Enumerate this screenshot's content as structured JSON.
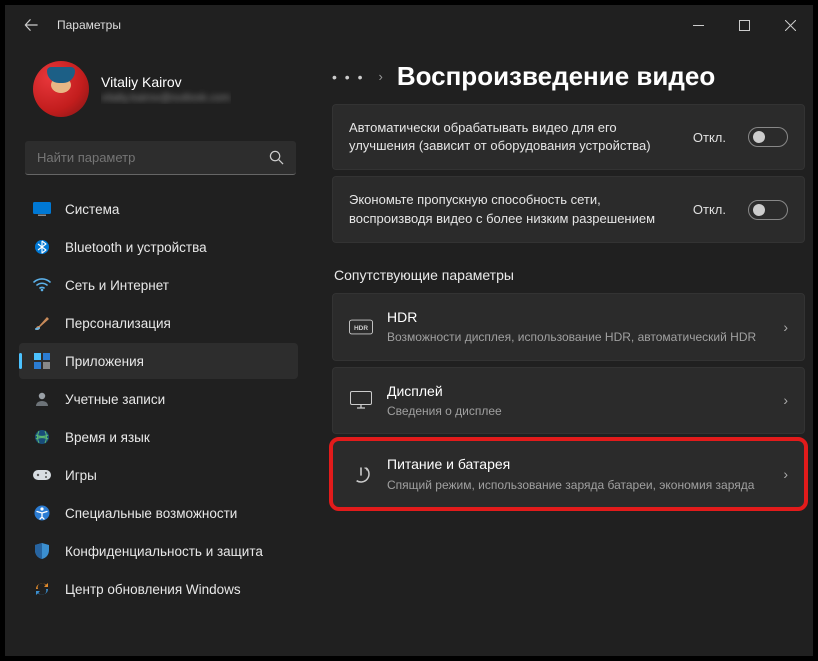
{
  "window": {
    "title": "Параметры"
  },
  "user": {
    "name": "Vitaliy Kairov",
    "email": "vitaliy.kairov@outlook.com"
  },
  "search": {
    "placeholder": "Найти параметр"
  },
  "sidebar": {
    "items": [
      {
        "label": "Система",
        "icon": "display"
      },
      {
        "label": "Bluetooth и устройства",
        "icon": "bluetooth"
      },
      {
        "label": "Сеть и Интернет",
        "icon": "wifi"
      },
      {
        "label": "Персонализация",
        "icon": "brush"
      },
      {
        "label": "Приложения",
        "icon": "apps",
        "selected": true
      },
      {
        "label": "Учетные записи",
        "icon": "person"
      },
      {
        "label": "Время и язык",
        "icon": "globe"
      },
      {
        "label": "Игры",
        "icon": "gamepad"
      },
      {
        "label": "Специальные возможности",
        "icon": "accessibility"
      },
      {
        "label": "Конфиденциальность и защита",
        "icon": "shield"
      },
      {
        "label": "Центр обновления Windows",
        "icon": "update"
      }
    ]
  },
  "page": {
    "breadcrumb_dots": "• • •",
    "title": "Воспроизведение видео"
  },
  "toggles": [
    {
      "text": "Автоматически обрабатывать видео для его улучшения (зависит от оборудования устройства)",
      "state_label": "Откл.",
      "on": false
    },
    {
      "text": "Экономьте пропускную способность сети, воспроизводя видео с более низким разрешением",
      "state_label": "Откл.",
      "on": false
    }
  ],
  "related": {
    "heading": "Сопутствующие параметры",
    "items": [
      {
        "title": "HDR",
        "subtitle": "Возможности дисплея, использование HDR, автоматический HDR",
        "icon": "hdr"
      },
      {
        "title": "Дисплей",
        "subtitle": "Сведения о дисплее",
        "icon": "monitor"
      },
      {
        "title": "Питание и батарея",
        "subtitle": "Спящий режим, использование заряда батареи, экономия заряда",
        "icon": "power",
        "highlight": true
      }
    ]
  }
}
